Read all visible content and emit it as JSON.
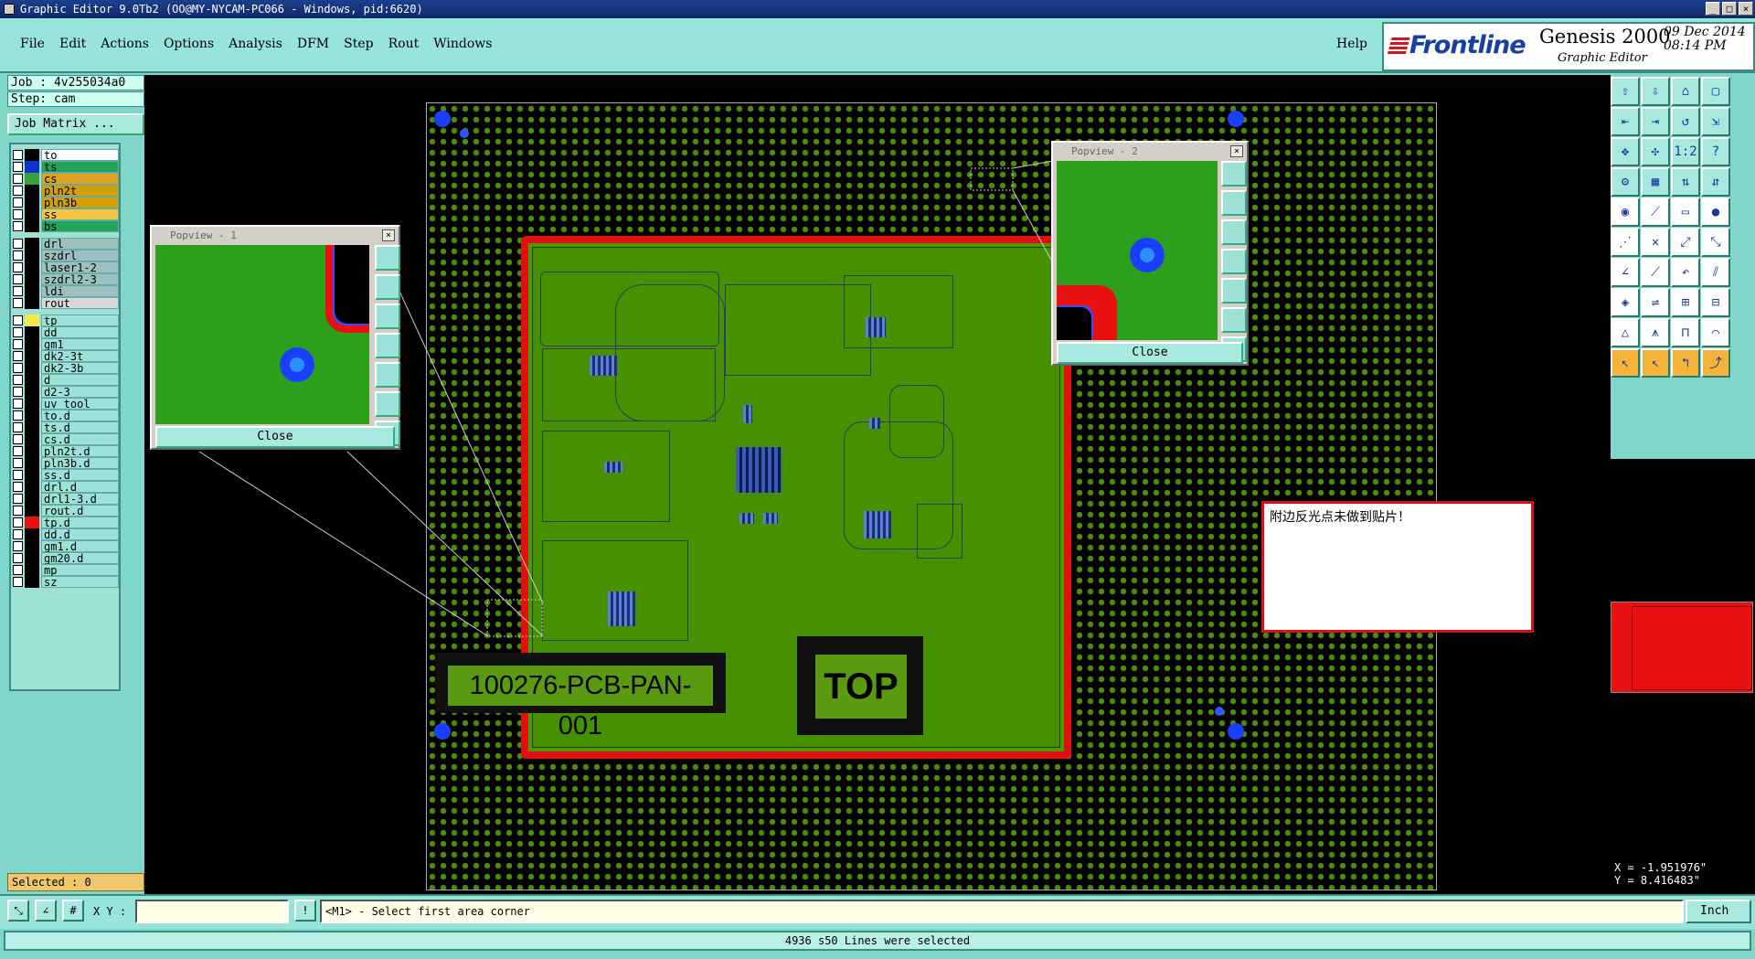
{
  "window": {
    "title": "Graphic Editor 9.0Tb2 (OO@MY-NYCAM-PC066 - Windows, pid:6620)"
  },
  "menu": {
    "items": [
      "File",
      "Edit",
      "Actions",
      "Options",
      "Analysis",
      "DFM",
      "Step",
      "Rout",
      "Windows"
    ],
    "help": "Help"
  },
  "brand": {
    "logo": "Frontline",
    "product": "Genesis 2000",
    "subtitle": "Graphic Editor",
    "date": "09 Dec 2014",
    "time": "08:14 PM"
  },
  "job": {
    "label": "Job : 4v255034a0",
    "step": "Step: cam",
    "matrix_button": "Job Matrix ..."
  },
  "layers": [
    {
      "name": "to",
      "color": "#ffffff"
    },
    {
      "name": "ts",
      "color": "#22a35a"
    },
    {
      "name": "cs",
      "color": "#e0a020"
    },
    {
      "name": "pln2t",
      "color": "#d4a000"
    },
    {
      "name": "pln3b",
      "color": "#d4a000"
    },
    {
      "name": "ss",
      "color": "#f5c542"
    },
    {
      "name": "bs",
      "color": "#22a35a"
    },
    {
      "name": "drl",
      "color": "#9cbfc0"
    },
    {
      "name": "szdrl",
      "color": "#9cbfc0"
    },
    {
      "name": "laser1-2",
      "color": "#9cbfc0"
    },
    {
      "name": "szdrl2-3",
      "color": "#9cbfc0"
    },
    {
      "name": "ldi",
      "color": "#9cbfc0"
    },
    {
      "name": "rout",
      "color": "#d8d8d8"
    },
    {
      "name": "tp",
      "color": "#9ce2d8"
    },
    {
      "name": "dd",
      "color": "#9ce2d8"
    },
    {
      "name": "gm1",
      "color": "#9ce2d8"
    },
    {
      "name": "dk2-3t",
      "color": "#9ce2d8"
    },
    {
      "name": "dk2-3b",
      "color": "#9ce2d8"
    },
    {
      "name": "d",
      "color": "#9ce2d8"
    },
    {
      "name": "d2-3",
      "color": "#9ce2d8"
    },
    {
      "name": "uv_tool",
      "color": "#9ce2d8"
    },
    {
      "name": "to.d",
      "color": "#9ce2d8"
    },
    {
      "name": "ts.d",
      "color": "#9ce2d8"
    },
    {
      "name": "cs.d",
      "color": "#9ce2d8"
    },
    {
      "name": "pln2t.d",
      "color": "#9ce2d8"
    },
    {
      "name": "pln3b.d",
      "color": "#9ce2d8"
    },
    {
      "name": "ss.d",
      "color": "#9ce2d8"
    },
    {
      "name": "drl.d",
      "color": "#9ce2d8"
    },
    {
      "name": "drl1-3.d",
      "color": "#9ce2d8"
    },
    {
      "name": "rout.d",
      "color": "#9ce2d8"
    },
    {
      "name": "tp.d",
      "color": "#9ce2d8"
    },
    {
      "name": "dd.d",
      "color": "#9ce2d8"
    },
    {
      "name": "gm1.d",
      "color": "#9ce2d8"
    },
    {
      "name": "gm20.d",
      "color": "#9ce2d8"
    },
    {
      "name": "mp",
      "color": "#9ce2d8"
    },
    {
      "name": "sz",
      "color": "#9ce2d8"
    }
  ],
  "selected": "Selected : 0",
  "popview1": {
    "title": "Popview - 1",
    "close": "Close"
  },
  "popview2": {
    "title": "Popview - 2",
    "close": "Close"
  },
  "note": "附边反光点未做到贴片！",
  "panel_labels": {
    "part_number": "100276-PCB-PAN-001",
    "side": "TOP"
  },
  "coords": {
    "x": "X = -1.951976\"",
    "y": "Y = 8.416483\""
  },
  "command": {
    "xy_label": "X Y :",
    "prompt": "<M1> - Select first area corner",
    "unit": "Inch"
  },
  "status": "4936 s50 Lines were selected",
  "colors": {
    "accent": "#96e4da",
    "board_outline": "#e01010",
    "copper": "#4a9a00",
    "pad": "#1a40ff"
  }
}
